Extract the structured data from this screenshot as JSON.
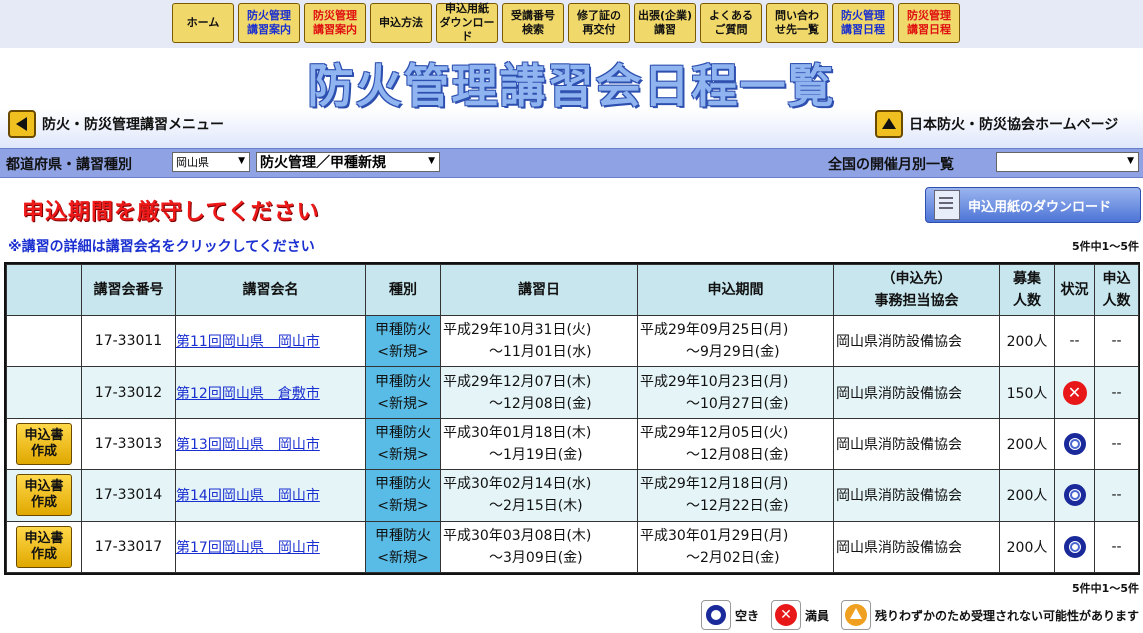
{
  "nav": [
    {
      "label": "ホーム",
      "color": "black"
    },
    {
      "label": "防火管理\n講習案内",
      "color": "blue"
    },
    {
      "label": "防災管理\n講習案内",
      "color": "red"
    },
    {
      "label": "申込方法",
      "color": "black"
    },
    {
      "label": "申込用紙\nダウンロード",
      "color": "black"
    },
    {
      "label": "受講番号\n検索",
      "color": "black"
    },
    {
      "label": "修了証の\n再交付",
      "color": "black"
    },
    {
      "label": "出張(企業)\n講習",
      "color": "black"
    },
    {
      "label": "よくある\nご質問",
      "color": "black"
    },
    {
      "label": "問い合わ\nせ先一覧",
      "color": "black"
    },
    {
      "label": "防火管理\n講習日程",
      "color": "blue"
    },
    {
      "label": "防災管理\n講習日程",
      "color": "red"
    }
  ],
  "header": {
    "title": "防火管理講習会日程一覧",
    "back_menu": "防火・防災管理講習メニュー",
    "home_link": "日本防火・防災協会ホームページ"
  },
  "filters": {
    "pref_label": "都道府県・講習種別",
    "pref_value": "岡山県",
    "type_value": "防火管理／甲種新規",
    "monthly_label": "全国の開催月別一覧",
    "monthly_value": ""
  },
  "notices": {
    "warning": "申込期間を厳守してください",
    "detail_note": "※講習の詳細は講習会名をクリックしてください",
    "download_button": "申込用紙のダウンロード",
    "count_top": "5件中1～5件",
    "count_bottom": "5件中1～5件"
  },
  "table": {
    "headers": {
      "no": "講習会番号",
      "name": "講習会名",
      "kind": "種別",
      "date": "講習日",
      "period": "申込期間",
      "assoc_1": "（申込先）",
      "assoc_2": "事務担当協会",
      "cap_1": "募集",
      "cap_2": "人数",
      "status": "状況",
      "apps_1": "申込",
      "apps_2": "人数"
    },
    "rows": [
      {
        "apply": "",
        "no": "17-33011",
        "name": "第11回岡山県　岡山市",
        "kind_1": "甲種防火",
        "kind_2": "<新規>",
        "date_1": "平成29年10月31日(火)",
        "date_2": "～11月01日(水)",
        "period_1": "平成29年09月25日(月)",
        "period_2": "～9月29日(金)",
        "assoc": "岡山県消防設備協会",
        "cap": "200人",
        "status": "--",
        "apps": "--"
      },
      {
        "apply": "",
        "no": "17-33012",
        "name": "第12回岡山県　倉敷市",
        "kind_1": "甲種防火",
        "kind_2": "<新規>",
        "date_1": "平成29年12月07日(木)",
        "date_2": "～12月08日(金)",
        "period_1": "平成29年10月23日(月)",
        "period_2": "～10月27日(金)",
        "assoc": "岡山県消防設備協会",
        "cap": "150人",
        "status": "full",
        "apps": "--"
      },
      {
        "apply": "申込書\n作成",
        "no": "17-33013",
        "name": "第13回岡山県　岡山市",
        "kind_1": "甲種防火",
        "kind_2": "<新規>",
        "date_1": "平成30年01月18日(木)",
        "date_2": "～1月19日(金)",
        "period_1": "平成29年12月05日(火)",
        "period_2": "～12月08日(金)",
        "assoc": "岡山県消防設備協会",
        "cap": "200人",
        "status": "open",
        "apps": "--"
      },
      {
        "apply": "申込書\n作成",
        "no": "17-33014",
        "name": "第14回岡山県　岡山市",
        "kind_1": "甲種防火",
        "kind_2": "<新規>",
        "date_1": "平成30年02月14日(水)",
        "date_2": "～2月15日(木)",
        "period_1": "平成29年12月18日(月)",
        "period_2": "～12月22日(金)",
        "assoc": "岡山県消防設備協会",
        "cap": "200人",
        "status": "open",
        "apps": "--"
      },
      {
        "apply": "申込書\n作成",
        "no": "17-33017",
        "name": "第17回岡山県　岡山市",
        "kind_1": "甲種防火",
        "kind_2": "<新規>",
        "date_1": "平成30年03月08日(木)",
        "date_2": "～3月09日(金)",
        "period_1": "平成30年01月29日(月)",
        "period_2": "～2月02日(金)",
        "assoc": "岡山県消防設備協会",
        "cap": "200人",
        "status": "open",
        "apps": "--"
      }
    ]
  },
  "legend": {
    "open": "空き",
    "full": "満員",
    "few": "残りわずかのため受理されない可能性があります"
  }
}
